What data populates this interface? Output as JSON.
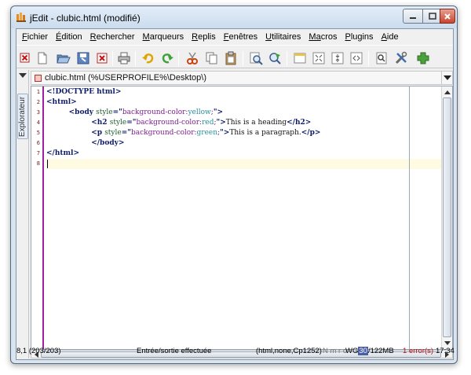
{
  "window": {
    "title": "jEdit - clubic.html (modifié)"
  },
  "menus": [
    {
      "accel": "F",
      "rest": "ichier"
    },
    {
      "accel": "É",
      "rest": "dition"
    },
    {
      "accel": "R",
      "rest": "echercher"
    },
    {
      "accel": "M",
      "rest": "arqueurs"
    },
    {
      "accel": "R",
      "rest": "eplis"
    },
    {
      "accel": "F",
      "rest": "enêtres"
    },
    {
      "accel": "U",
      "rest": "tilitaires"
    },
    {
      "accel": "Ma",
      "rest": "cros"
    },
    {
      "accel": "P",
      "rest": "lugins"
    },
    {
      "accel": "A",
      "rest": "ide"
    }
  ],
  "toolbar": {
    "icons": [
      "new-file-icon",
      "open-file-icon",
      "save-icon",
      "close-file-icon",
      "print-icon",
      "undo-icon",
      "redo-icon",
      "cut-icon",
      "copy-icon",
      "paste-icon",
      "find-icon",
      "replace-icon",
      "new-view-icon",
      "fold-all-icon",
      "split-icon",
      "unsplit-icon",
      "search-buffer-icon",
      "global-options-icon",
      "plugin-manager-icon"
    ]
  },
  "dock": {
    "tab_label": "Explorateur"
  },
  "buffer": {
    "name": "clubic.html (%USERPROFILE%\\Desktop\\)"
  },
  "editor": {
    "line_numbers": [
      "1",
      "2",
      "3",
      "4",
      "5",
      "6",
      "7",
      "8"
    ],
    "lines": [
      [
        {
          "t": "<!DOCTYPE html>",
          "c": "kw"
        }
      ],
      [
        {
          "t": "<html>",
          "c": "kw"
        }
      ],
      [
        {
          "t": "          ",
          "c": "txt"
        },
        {
          "t": "<body ",
          "c": "kw"
        },
        {
          "t": "style",
          "c": "at"
        },
        {
          "t": "=\"",
          "c": "kw"
        },
        {
          "t": "background-color:",
          "c": "sv"
        },
        {
          "t": "yellow",
          "c": "sv2"
        },
        {
          "t": ";",
          "c": "sv"
        },
        {
          "t": "\">",
          "c": "kw"
        }
      ],
      [
        {
          "t": "                    ",
          "c": "txt"
        },
        {
          "t": "<h2 ",
          "c": "kw"
        },
        {
          "t": "style",
          "c": "at"
        },
        {
          "t": "=\"",
          "c": "kw"
        },
        {
          "t": "background-color:",
          "c": "sv"
        },
        {
          "t": "red",
          "c": "sv2"
        },
        {
          "t": ";",
          "c": "sv"
        },
        {
          "t": "\">",
          "c": "kw"
        },
        {
          "t": "This is a heading",
          "c": "txt"
        },
        {
          "t": "</h2>",
          "c": "kw"
        }
      ],
      [
        {
          "t": "                    ",
          "c": "txt"
        },
        {
          "t": "<p ",
          "c": "kw"
        },
        {
          "t": "style",
          "c": "at"
        },
        {
          "t": "=\"",
          "c": "kw"
        },
        {
          "t": "background-color:",
          "c": "sv"
        },
        {
          "t": "green",
          "c": "sv2"
        },
        {
          "t": ";",
          "c": "sv"
        },
        {
          "t": "\">",
          "c": "kw"
        },
        {
          "t": "This is a paragraph.",
          "c": "txt"
        },
        {
          "t": "</p>",
          "c": "kw"
        }
      ],
      [
        {
          "t": "                    ",
          "c": "txt"
        },
        {
          "t": "</body>",
          "c": "kw"
        }
      ],
      [
        {
          "t": "</html>",
          "c": "kw"
        }
      ],
      [
        {
          "t": "",
          "c": "txt"
        }
      ]
    ]
  },
  "status": {
    "caret": "8,1 (203/203)",
    "message": "Entrée/sortie effectuée",
    "mode": "(html,none,Cp1252)",
    "flags": "N m r o",
    "memory_left": "WG",
    "memory_mid": "30",
    "memory_right": "/122MB",
    "errors": "1 error(s)",
    "clock": "17:34"
  }
}
